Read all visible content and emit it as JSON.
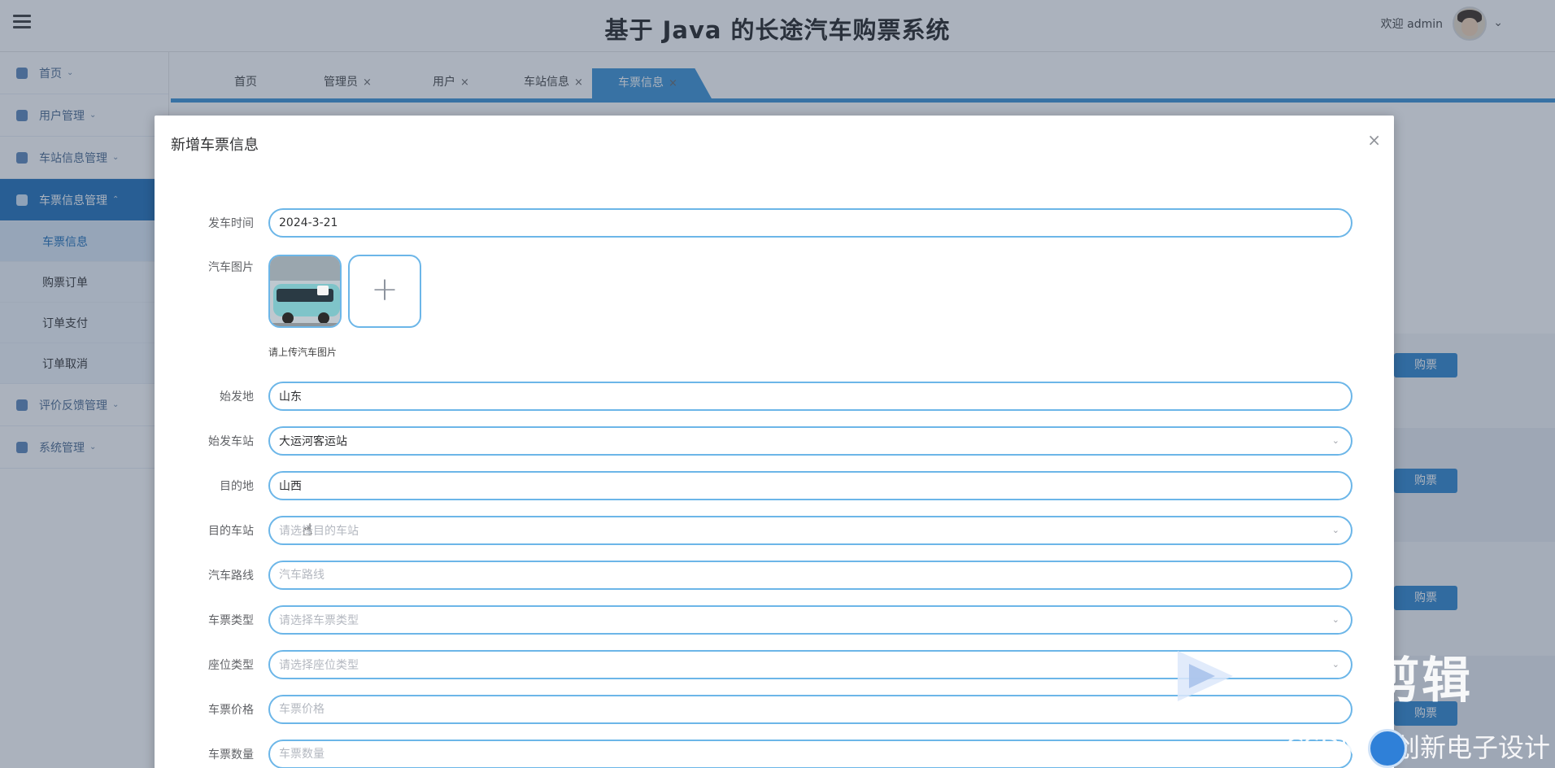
{
  "app": {
    "title": "基于 Java 的长途汽车购票系统",
    "welcome": "欢迎 admin"
  },
  "sidebar": {
    "items": [
      {
        "label": "首页"
      },
      {
        "label": "用户管理"
      },
      {
        "label": "车站信息管理"
      },
      {
        "label": "车票信息管理"
      },
      {
        "label": "评价反馈管理"
      },
      {
        "label": "系统管理"
      }
    ],
    "sub_items": [
      {
        "label": "车票信息"
      },
      {
        "label": "购票订单"
      },
      {
        "label": "订单支付"
      },
      {
        "label": "订单取消"
      }
    ]
  },
  "tabs": [
    {
      "label": "首页"
    },
    {
      "label": "管理员"
    },
    {
      "label": "用户"
    },
    {
      "label": "车站信息"
    },
    {
      "label": "车票信息"
    }
  ],
  "tab_close": "×",
  "list_buy_label": "购票",
  "dialog": {
    "title": "新增车票信息",
    "close": "×",
    "fields": {
      "departure_time": {
        "label": "发车时间",
        "value": "2024-3-21"
      },
      "bus_image": {
        "label": "汽车图片",
        "hint": "请上传汽车图片",
        "add": "+"
      },
      "origin": {
        "label": "始发地",
        "value": "山东"
      },
      "origin_station": {
        "label": "始发车站",
        "value": "大运河客运站"
      },
      "destination": {
        "label": "目的地",
        "value": "山西"
      },
      "dest_station": {
        "label": "目的车站",
        "placeholder": "请选择目的车站"
      },
      "route": {
        "label": "汽车路线",
        "placeholder": "汽车路线"
      },
      "ticket_type": {
        "label": "车票类型",
        "placeholder": "请选择车票类型"
      },
      "seat_type": {
        "label": "座位类型",
        "placeholder": "请选择座位类型"
      },
      "price": {
        "label": "车票价格",
        "placeholder": "车票价格"
      },
      "quantity": {
        "label": "车票数量",
        "placeholder": "车票数量"
      }
    }
  },
  "watermark": {
    "big": "剪辑",
    "csdn": "CSDN @创新电子设计"
  },
  "colors": {
    "primary": "#3a92d4",
    "input_border": "#6cb6e8",
    "sidebar_active": "#1e6fb8"
  }
}
